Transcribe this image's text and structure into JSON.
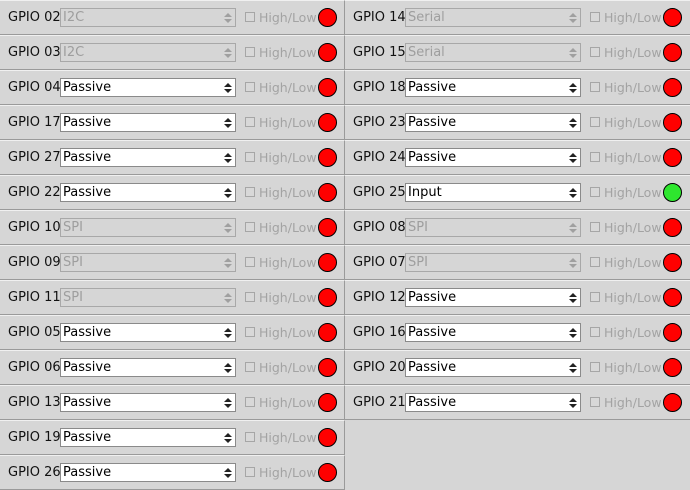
{
  "checkbox_label": "High/Low",
  "colors": {
    "off": "#ff0000",
    "on": "#2ee62e"
  },
  "left": [
    {
      "gpio": "GPIO 02",
      "mode": "I2C",
      "enabled": false,
      "state": "off"
    },
    {
      "gpio": "GPIO 03",
      "mode": "I2C",
      "enabled": false,
      "state": "off"
    },
    {
      "gpio": "GPIO 04",
      "mode": "Passive",
      "enabled": true,
      "state": "off"
    },
    {
      "gpio": "GPIO 17",
      "mode": "Passive",
      "enabled": true,
      "state": "off"
    },
    {
      "gpio": "GPIO 27",
      "mode": "Passive",
      "enabled": true,
      "state": "off"
    },
    {
      "gpio": "GPIO 22",
      "mode": "Passive",
      "enabled": true,
      "state": "off"
    },
    {
      "gpio": "GPIO 10",
      "mode": "SPI",
      "enabled": false,
      "state": "off"
    },
    {
      "gpio": "GPIO 09",
      "mode": "SPI",
      "enabled": false,
      "state": "off"
    },
    {
      "gpio": "GPIO 11",
      "mode": "SPI",
      "enabled": false,
      "state": "off"
    },
    {
      "gpio": "GPIO 05",
      "mode": "Passive",
      "enabled": true,
      "state": "off"
    },
    {
      "gpio": "GPIO 06",
      "mode": "Passive",
      "enabled": true,
      "state": "off"
    },
    {
      "gpio": "GPIO 13",
      "mode": "Passive",
      "enabled": true,
      "state": "off"
    },
    {
      "gpio": "GPIO 19",
      "mode": "Passive",
      "enabled": true,
      "state": "off"
    },
    {
      "gpio": "GPIO 26",
      "mode": "Passive",
      "enabled": true,
      "state": "off"
    }
  ],
  "right": [
    {
      "gpio": "GPIO 14",
      "mode": "Serial",
      "enabled": false,
      "state": "off"
    },
    {
      "gpio": "GPIO 15",
      "mode": "Serial",
      "enabled": false,
      "state": "off"
    },
    {
      "gpio": "GPIO 18",
      "mode": "Passive",
      "enabled": true,
      "state": "off"
    },
    {
      "gpio": "GPIO 23",
      "mode": "Passive",
      "enabled": true,
      "state": "off"
    },
    {
      "gpio": "GPIO 24",
      "mode": "Passive",
      "enabled": true,
      "state": "off"
    },
    {
      "gpio": "GPIO 25",
      "mode": "Input",
      "enabled": true,
      "state": "on"
    },
    {
      "gpio": "GPIO 08",
      "mode": "SPI",
      "enabled": false,
      "state": "off"
    },
    {
      "gpio": "GPIO 07",
      "mode": "SPI",
      "enabled": false,
      "state": "off"
    },
    {
      "gpio": "GPIO 12",
      "mode": "Passive",
      "enabled": true,
      "state": "off"
    },
    {
      "gpio": "GPIO 16",
      "mode": "Passive",
      "enabled": true,
      "state": "off"
    },
    {
      "gpio": "GPIO 20",
      "mode": "Passive",
      "enabled": true,
      "state": "off"
    },
    {
      "gpio": "GPIO 21",
      "mode": "Passive",
      "enabled": true,
      "state": "off"
    }
  ]
}
